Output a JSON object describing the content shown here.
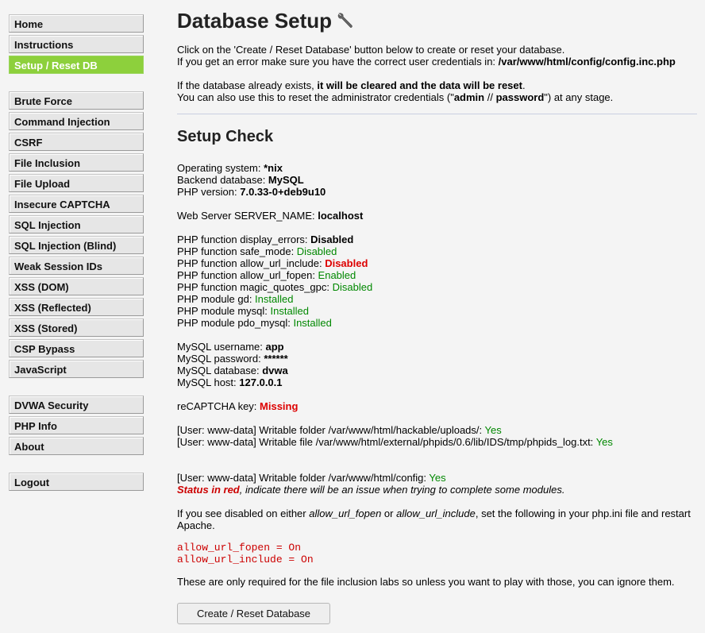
{
  "menu": {
    "block1": [
      {
        "label": "Home"
      },
      {
        "label": "Instructions"
      },
      {
        "label": "Setup / Reset DB"
      }
    ],
    "block2": [
      {
        "label": "Brute Force"
      },
      {
        "label": "Command Injection"
      },
      {
        "label": "CSRF"
      },
      {
        "label": "File Inclusion"
      },
      {
        "label": "File Upload"
      },
      {
        "label": "Insecure CAPTCHA"
      },
      {
        "label": "SQL Injection"
      },
      {
        "label": "SQL Injection (Blind)"
      },
      {
        "label": "Weak Session IDs"
      },
      {
        "label": "XSS (DOM)"
      },
      {
        "label": "XSS (Reflected)"
      },
      {
        "label": "XSS (Stored)"
      },
      {
        "label": "CSP Bypass"
      },
      {
        "label": "JavaScript"
      }
    ],
    "block3": [
      {
        "label": "DVWA Security"
      },
      {
        "label": "PHP Info"
      },
      {
        "label": "About"
      }
    ],
    "block4": [
      {
        "label": "Logout"
      }
    ],
    "selected_label": "Setup / Reset DB",
    "selected_color": "#8dd03c"
  },
  "page": {
    "title": "Database Setup",
    "title_icon": "wrench-icon",
    "intro1": "Click on the 'Create / Reset Database' button below to create or reset your database.",
    "intro2_prefix": "If you get an error make sure you have the correct user credentials in: ",
    "config_path": "/var/www/html/config/config.inc.php",
    "exists_prefix": "If the database already exists, ",
    "exists_bold": "it will be cleared and the data will be reset",
    "exists_suffix": ".",
    "reset_prefix": "You can also use this to reset the administrator credentials (\"",
    "admin_user": "admin",
    "reset_sep": " // ",
    "admin_pass": "password",
    "reset_suffix": "\") at any stage."
  },
  "setup_check": {
    "heading": "Setup Check",
    "os_label": "Operating system: ",
    "os_value": "*nix",
    "db_label": "Backend database: ",
    "db_value": "MySQL",
    "php_label": "PHP version: ",
    "php_value": "7.0.33-0+deb9u10",
    "server_label": "Web Server SERVER_NAME: ",
    "server_value": "localhost",
    "display_errors_label": "PHP function display_errors: ",
    "display_errors_value": "Disabled",
    "safe_mode_label": "PHP function safe_mode: ",
    "safe_mode_value": "Disabled",
    "url_include_label": "PHP function allow_url_include: ",
    "url_include_value": "Disabled",
    "url_fopen_label": "PHP function allow_url_fopen: ",
    "url_fopen_value": "Enabled",
    "magic_quotes_label": "PHP function magic_quotes_gpc: ",
    "magic_quotes_value": "Disabled",
    "gd_label": "PHP module gd: ",
    "gd_value": "Installed",
    "mysql_mod_label": "PHP module mysql: ",
    "mysql_mod_value": "Installed",
    "pdo_label": "PHP module pdo_mysql: ",
    "pdo_value": "Installed",
    "mysql_user_label": "MySQL username: ",
    "mysql_user_value": "app",
    "mysql_pass_label": "MySQL password: ",
    "mysql_pass_value": "******",
    "mysql_db_label": "MySQL database: ",
    "mysql_db_value": "dvwa",
    "mysql_host_label": "MySQL host: ",
    "mysql_host_value": "127.0.0.1",
    "recaptcha_label": "reCAPTCHA key: ",
    "recaptcha_value": "Missing",
    "uploads_label": "[User: www-data] Writable folder /var/www/html/hackable/uploads/: ",
    "uploads_value": "Yes",
    "phpids_label": "[User: www-data] Writable file /var/www/html/external/phpids/0.6/lib/IDS/tmp/phpids_log.txt: ",
    "phpids_value": "Yes",
    "config_label": "[User: www-data] Writable folder /var/www/html/config: ",
    "config_value": "Yes",
    "status_red": "Status in red",
    "status_rest": ", indicate there will be an issue when trying to complete some modules.",
    "disabled_prefix": "If you see disabled on either ",
    "disabled_fopen": "allow_url_fopen",
    "disabled_or": " or ",
    "disabled_include": "allow_url_include",
    "disabled_suffix": ", set the following in your php.ini file and restart Apache.",
    "code_line1": "allow_url_fopen = On",
    "code_line2": "allow_url_include = On",
    "footer_note": "These are only required for the file inclusion labs so unless you want to play with those, you can ignore them."
  },
  "button": {
    "label": "Create / Reset Database"
  },
  "colors": {
    "ok": "#008800",
    "error": "#dd0000"
  }
}
